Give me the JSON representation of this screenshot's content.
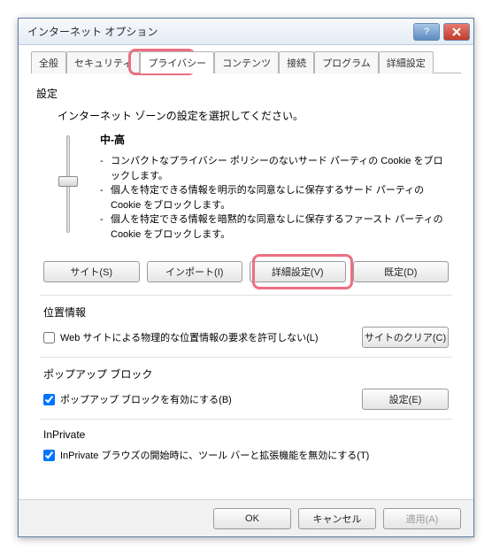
{
  "window": {
    "title": "インターネット オプション"
  },
  "tabs": [
    "全般",
    "セキュリティ",
    "プライバシー",
    "コンテンツ",
    "接続",
    "プログラム",
    "詳細設定"
  ],
  "settings": {
    "heading": "設定",
    "desc": "インターネット ゾーンの設定を選択してください。",
    "level_name": "中-高",
    "bullets": [
      "コンパクトなプライバシー ポリシーのないサード パーティの Cookie をブロックします。",
      "個人を特定できる情報を明示的な同意なしに保存するサード パーティの Cookie をブロックします。",
      "個人を特定できる情報を暗黙的な同意なしに保存するファースト パーティの Cookie をブロックします。"
    ]
  },
  "buttons": {
    "sites": "サイト(S)",
    "import": "インポート(I)",
    "advanced": "詳細設定(V)",
    "default": "既定(D)"
  },
  "location": {
    "heading": "位置情報",
    "checkbox_label": "Web サイトによる物理的な位置情報の要求を許可しない(L)",
    "clear": "サイトのクリア(C)"
  },
  "popup": {
    "heading": "ポップアップ ブロック",
    "checkbox_label": "ポップアップ ブロックを有効にする(B)",
    "settings": "設定(E)"
  },
  "inprivate": {
    "heading": "InPrivate",
    "checkbox_label": "InPrivate ブラウズの開始時に、ツール バーと拡張機能を無効にする(T)"
  },
  "footer": {
    "ok": "OK",
    "cancel": "キャンセル",
    "apply": "適用(A)"
  }
}
